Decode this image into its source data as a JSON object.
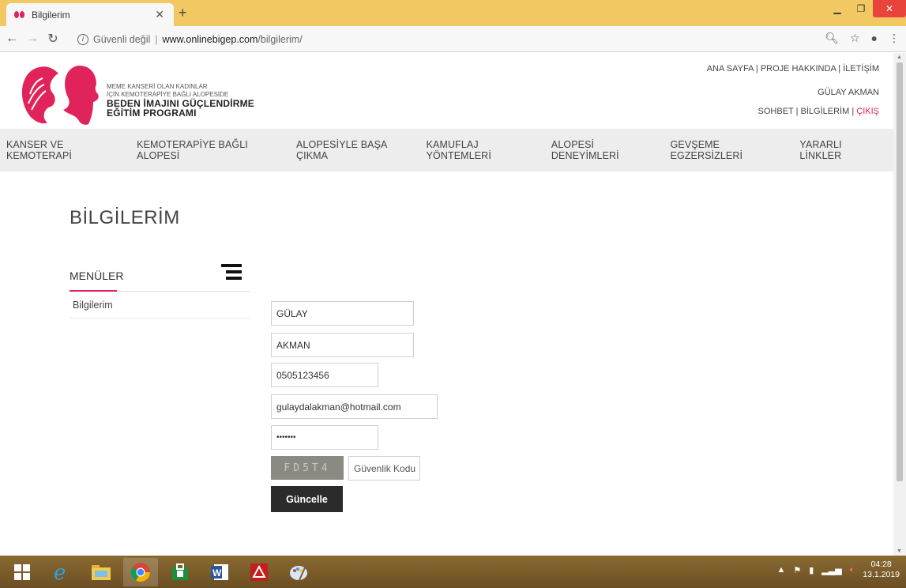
{
  "browser": {
    "tab_title": "Bilgilerim",
    "new_tab_symbol": "+",
    "security_label": "Güvenli değil",
    "url_host": "www.onlinebigep.com",
    "url_path": "/bilgilerim/"
  },
  "brand": {
    "line1": "MEME KANSERİ OLAN KADINLAR",
    "line2": "İÇİN KEMOTERAPİYE BAĞLI ALOPESİDE",
    "line3": "BEDEN İMAJINI GÜÇLENDİRME",
    "line4": "EĞİTİM PROGRAMI",
    "accent_color": "#e0235a"
  },
  "top_links": {
    "home": "ANA SAYFA",
    "about": "PROJE HAKKINDA",
    "contact": "İLETİŞİM",
    "user_name": "GÜLAY AKMAN",
    "chat": "SOHBET",
    "my_info": "BİLGİLERİM",
    "logout": "ÇIKIŞ"
  },
  "main_nav": [
    "KANSER VE KEMOTERAPİ",
    "KEMOTERAPİYE BAĞLI ALOPESİ",
    "ALOPESİYLE BAŞA ÇIKMA",
    "KAMUFLAJ YÖNTEMLERİ",
    "ALOPESİ DENEYİMLERİ",
    "GEVŞEME EGZERSİZLERİ",
    "YARARLI LİNKLER"
  ],
  "page": {
    "title": "BİLGİLERİM",
    "menu_header": "MENÜLER",
    "menu_item": "Bilgilerim"
  },
  "form": {
    "first_name": "GÜLAY",
    "last_name": "AKMAN",
    "phone": "0505123456",
    "email": "gulaydalakman@hotmail.com",
    "password": "•••••••",
    "captcha_text": "FD5T4",
    "security_code_placeholder": "Güvenlik Kodu",
    "update_button": "Güncelle"
  },
  "taskbar": {
    "time": "04:28",
    "date": "13.1.2019"
  }
}
